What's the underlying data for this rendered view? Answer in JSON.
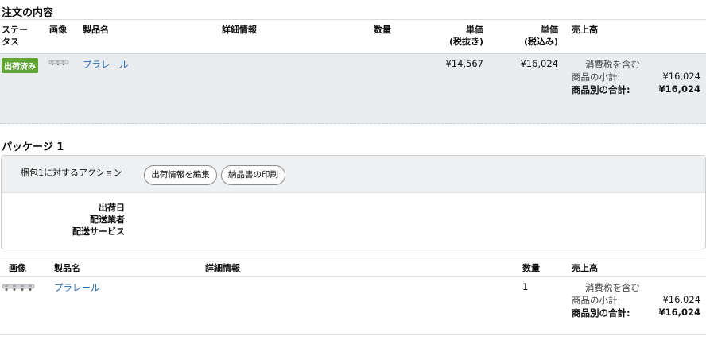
{
  "order": {
    "section_title": "注文の内容",
    "headers": {
      "status": "ステー\nタス",
      "image": "画像",
      "product": "製品名",
      "details": "詳細情報",
      "quantity": "数量",
      "unit_price_ex": "単価\n(税抜き)",
      "unit_price_in": "単価\n(税込み)",
      "sales": "売上高"
    },
    "row": {
      "status_badge": "出荷済み",
      "product_name": "プラレール",
      "unit_price_ex": "¥14,567",
      "unit_price_in": "¥16,024",
      "tax_note": "消費税を含む",
      "subtotal_label": "商品の小計:",
      "subtotal_value": "¥16,024",
      "total_label": "商品別の合計:",
      "total_value": "¥16,024"
    }
  },
  "package": {
    "title": "パッケージ 1",
    "action_label": "梱包1に対するアクション",
    "edit_button": "出荷情報を編集",
    "print_button": "納品書の印刷",
    "ship_date_label": "出荷日",
    "carrier_label": "配送業者",
    "service_label": "配送サービス"
  },
  "items": {
    "headers": {
      "image": "画像",
      "product": "製品名",
      "details": "詳細情報",
      "quantity": "数量",
      "sales": "売上高"
    },
    "row": {
      "product_name": "プラレール",
      "quantity": "1",
      "tax_note": "消費税を含む",
      "subtotal_label": "商品の小計:",
      "subtotal_value": "¥16,024",
      "total_label": "商品別の合計:",
      "total_value": "¥16,024"
    }
  },
  "colors": {
    "status_badge": "#5ea534",
    "link": "#2a6bb5",
    "row_background": "#eaedef"
  },
  "icons": {
    "product_thumbnail": "train-toy-image"
  }
}
